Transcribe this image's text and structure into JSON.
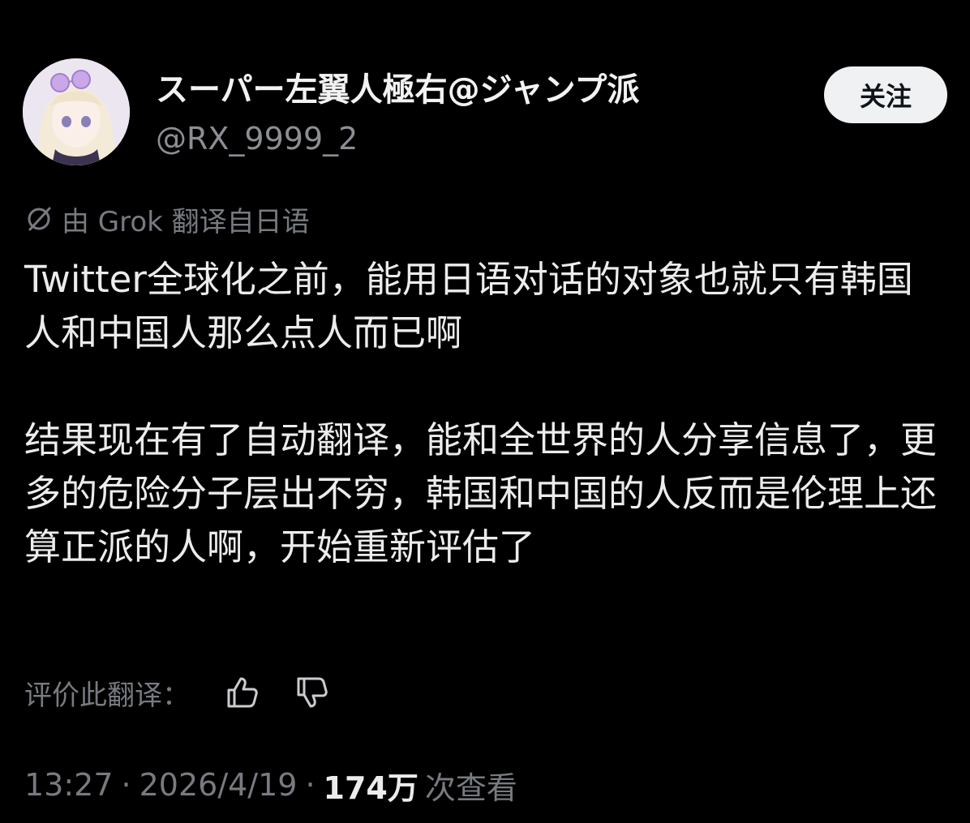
{
  "post": {
    "author": {
      "display_name": "スーパー左翼人極右@ジャンプ派",
      "handle": "@RX_9999_2"
    },
    "follow_label": "关注",
    "translation_notice": "由 Grok 翻译自日语",
    "body": {
      "paragraph_1": "Twitter全球化之前，能用日语对话的对象也就只有韩国人和中国人那么点人而已啊",
      "paragraph_2": "结果现在有了自动翻译，能和全世界的人分享信息了，更多的危险分子层出不穷，韩国和中国的人反而是伦理上还算正派的人啊，开始重新评估了"
    },
    "rate_translation_label": "评价此翻译：",
    "meta": {
      "time": "13:27",
      "separator": "·",
      "date": "2026/4/19",
      "views_count": "174万",
      "views_label": "次查看"
    }
  },
  "icons": {
    "translate": "translate-icon",
    "thumbs_up": "thumbs-up-icon",
    "thumbs_down": "thumbs-down-icon"
  },
  "colors": {
    "background": "#000000",
    "text_primary": "#ececec",
    "text_secondary": "#777b80",
    "follow_button_bg": "#eff1f2"
  }
}
